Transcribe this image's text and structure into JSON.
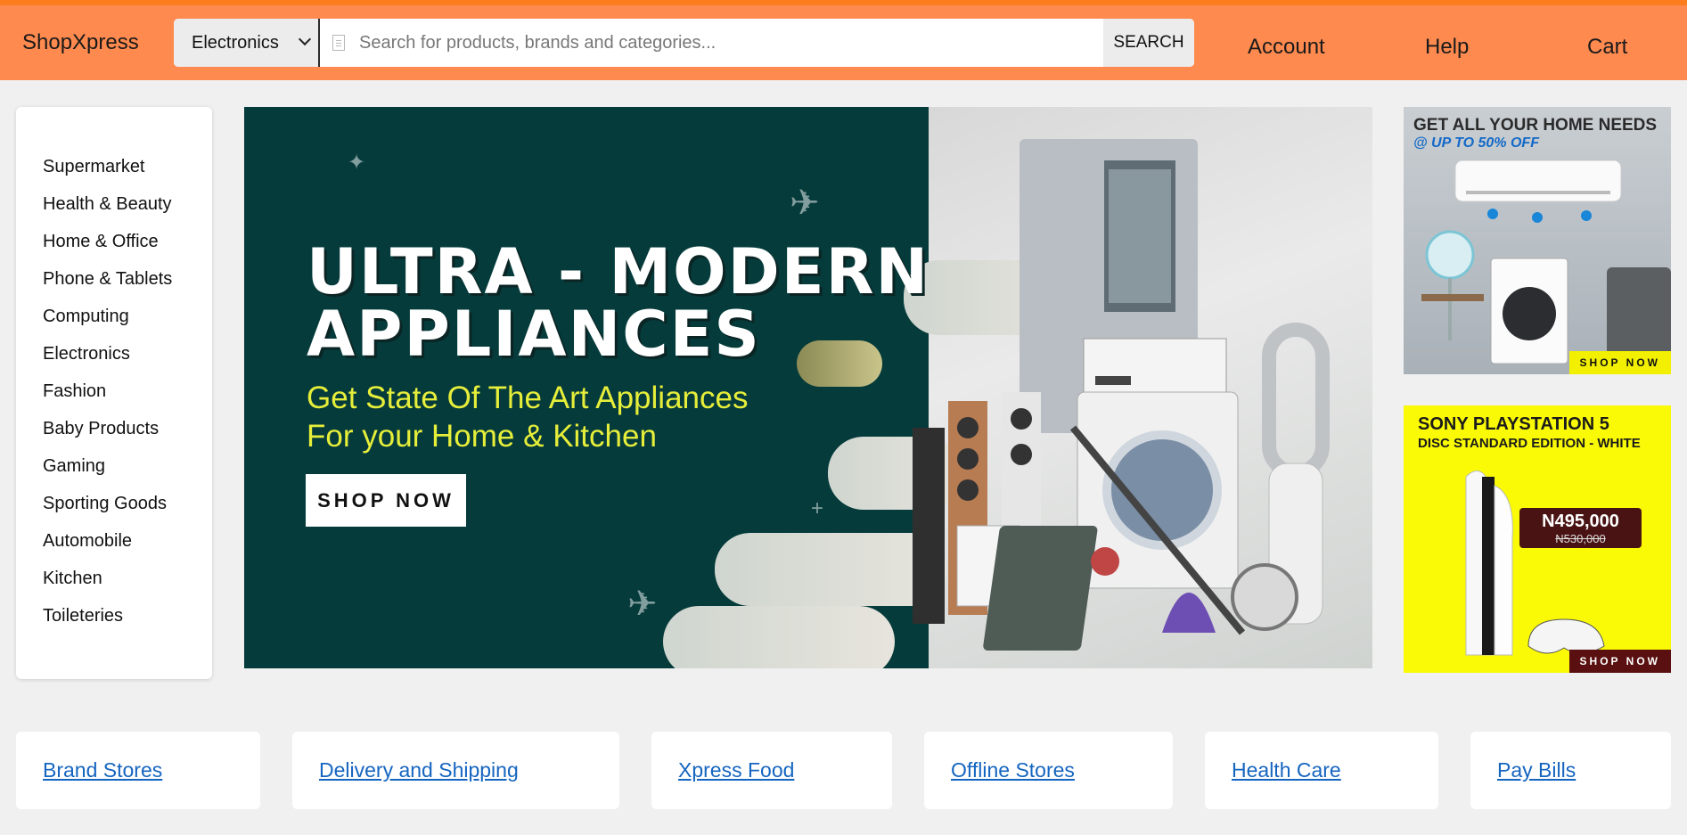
{
  "header": {
    "brand": "ShopXpress",
    "category_select": "Electronics",
    "search_placeholder": "Search for products, brands and categories...",
    "search_button": "SEARCH",
    "nav": [
      "Account",
      "Help",
      "Cart"
    ],
    "colors": {
      "bar": "#fe8a4f",
      "accent_stripe": "#fb7d1e"
    }
  },
  "sidebar": {
    "items": [
      "Supermarket",
      "Health & Beauty",
      "Home & Office",
      "Phone & Tablets",
      "Computing",
      "Electronics",
      "Fashion",
      "Baby Products",
      "Gaming",
      "Sporting Goods",
      "Automobile",
      "Kitchen",
      "Toileteries"
    ]
  },
  "hero": {
    "title_line1": "ULTRA - MODERN",
    "title_line2": "APPLIANCES",
    "subtitle_line1": "Get State Of The Art Appliances",
    "subtitle_line2": "For your Home & Kitchen",
    "cta": "SHOP NOW",
    "colors": {
      "background": "#053b3b",
      "subtitle": "#e6ee3a"
    }
  },
  "promos": {
    "home": {
      "title": "GET ALL YOUR HOME NEEDS",
      "subtitle": "@ UP TO 50% OFF",
      "cta": "SHOP NOW",
      "icon": "home-appliances-image"
    },
    "ps5": {
      "title": "SONY PLAYSTATION 5",
      "subtitle": "DISC STANDARD EDITION - WHITE",
      "price": "N495,000",
      "old_price": "N530,000",
      "cta": "SHOP NOW",
      "icon": "playstation-console-image"
    }
  },
  "quick_links": [
    "Brand Stores",
    "Delivery and Shipping",
    "Xpress Food",
    "Offline Stores",
    "Health Care",
    "Pay Bills"
  ]
}
